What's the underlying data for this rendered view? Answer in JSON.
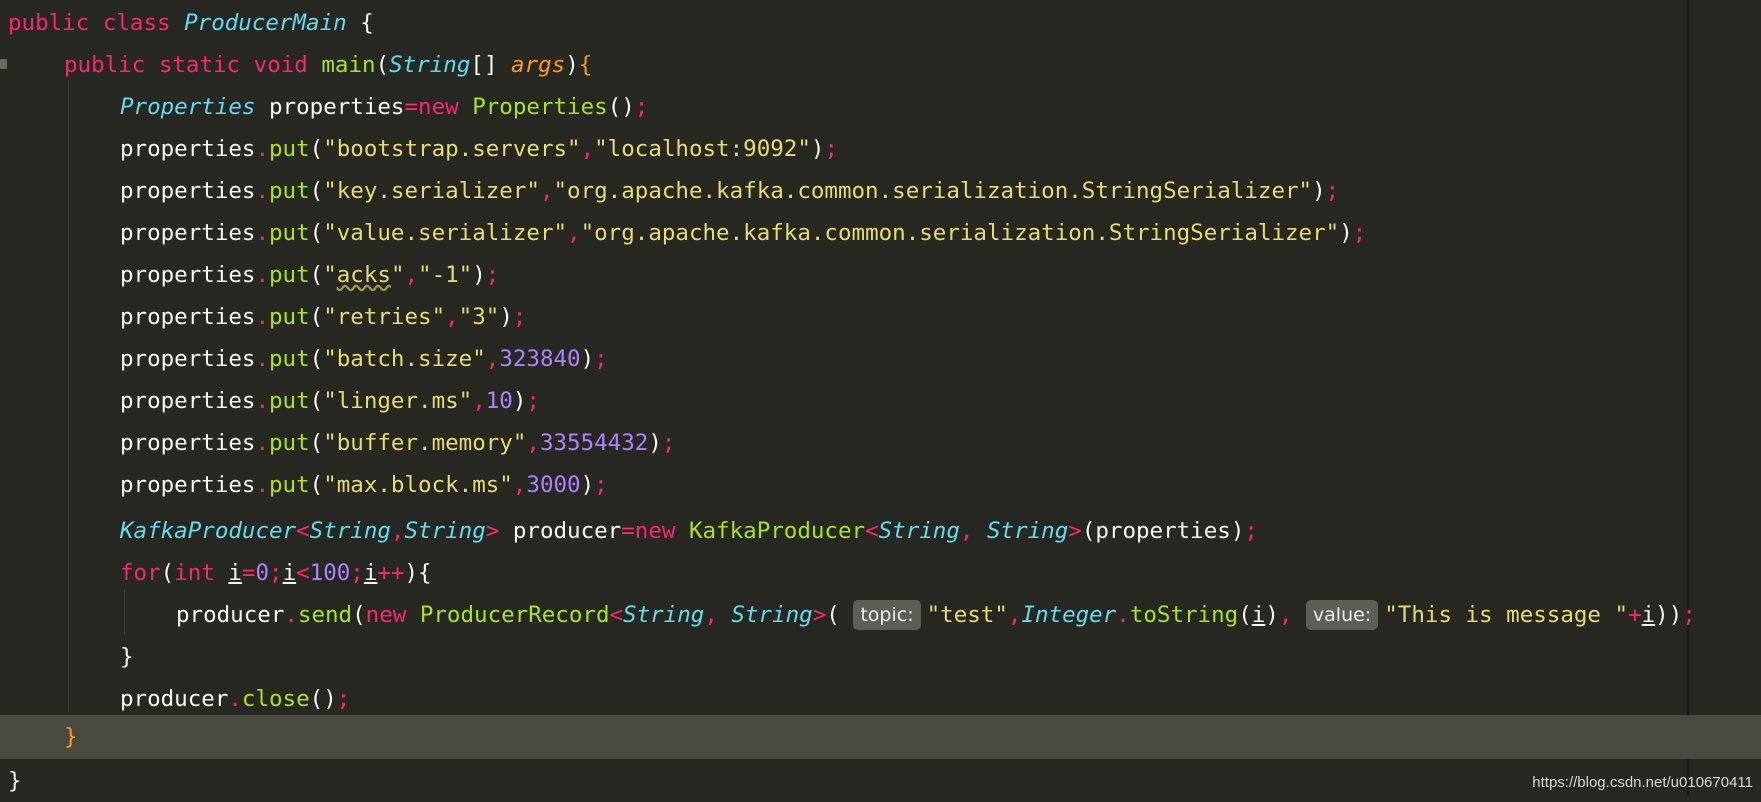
{
  "editor": {
    "class_decl": {
      "public": "public",
      "class": "class",
      "name": "ProducerMain",
      "brace": "{"
    },
    "main_decl": {
      "public": "public",
      "static": "static",
      "void": "void",
      "name": "main",
      "param_type": "String",
      "param_name": "args"
    },
    "properties_decl": {
      "type": "Properties",
      "var": "properties",
      "new": "new",
      "ctor": "Properties"
    },
    "puts": [
      {
        "key": "bootstrap.servers",
        "value": "localhost:9092",
        "kind": "string"
      },
      {
        "key": "key.serializer",
        "value": "org.apache.kafka.common.serialization.StringSerializer",
        "kind": "string"
      },
      {
        "key": "value.serializer",
        "value": "org.apache.kafka.common.serialization.StringSerializer",
        "kind": "string"
      },
      {
        "key": "acks",
        "value": "-1",
        "kind": "string"
      },
      {
        "key": "retries",
        "value": "3",
        "kind": "string"
      },
      {
        "key": "batch.size",
        "value": "323840",
        "kind": "number"
      },
      {
        "key": "linger.ms",
        "value": "10",
        "kind": "number"
      },
      {
        "key": "buffer.memory",
        "value": "33554432",
        "kind": "number"
      },
      {
        "key": "max.block.ms",
        "value": "3000",
        "kind": "number"
      }
    ],
    "producer_decl": {
      "type": "KafkaProducer",
      "generic": "String",
      "var": "producer",
      "new": "new",
      "arg": "properties"
    },
    "for_loop": {
      "for": "for",
      "int": "int",
      "var": "i",
      "start": "0",
      "limit": "100"
    },
    "send_stmt": {
      "target": "producer",
      "method": "send",
      "new": "new",
      "record": "ProducerRecord",
      "generic": "String",
      "topic_hint": "topic:",
      "topic": "\"test\"",
      "int_class": "Integer",
      "to_string": "toString",
      "var": "i",
      "value_hint": "value:",
      "message": "\"This is message \""
    },
    "close_stmt": {
      "target": "producer",
      "method": "close"
    }
  },
  "watermark": "https://blog.csdn.net/u010670411",
  "colors": {
    "background": "#272822",
    "current_line": "#4a4a40",
    "keyword": "#f92672",
    "type": "#66d9ef",
    "function": "#a6e22e",
    "string": "#e6db74",
    "number": "#ae81ff",
    "parameter": "#fd971f"
  }
}
